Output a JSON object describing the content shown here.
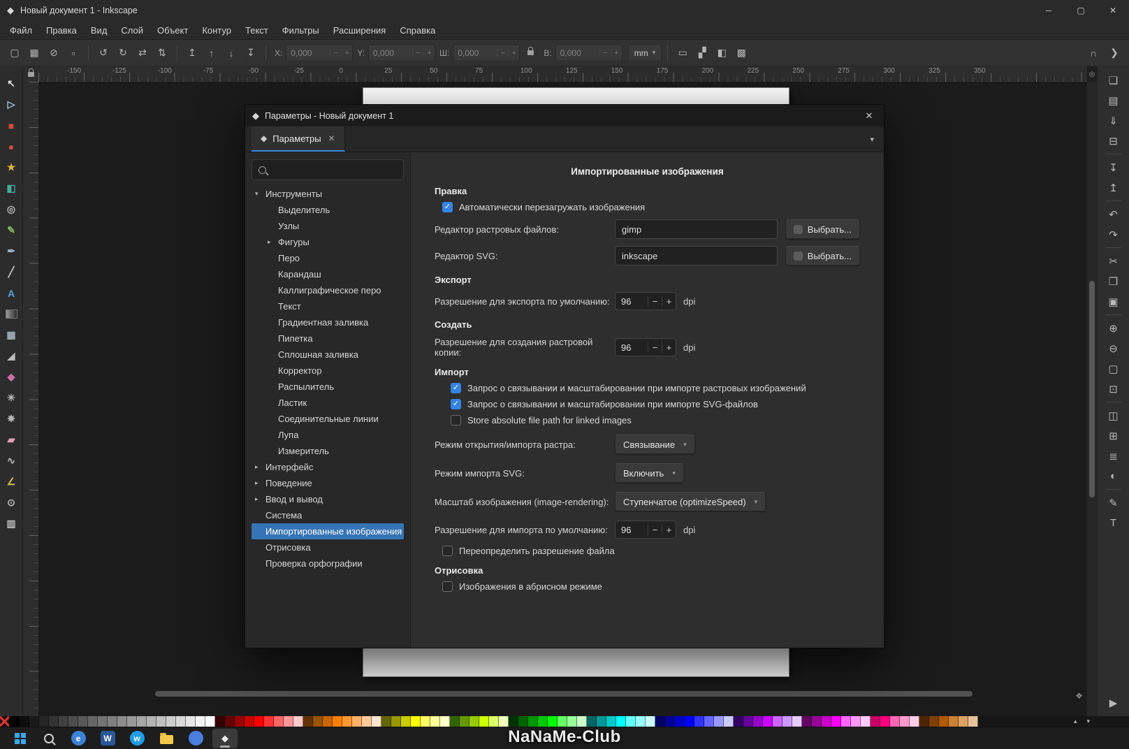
{
  "icons": {
    "app_logo": "◆",
    "minimize": "─",
    "maximize": "▢",
    "close": "✕",
    "chevron_down": "▾",
    "triangle_down": "▾",
    "triangle_right": "▸",
    "check": "✓",
    "minus": "−",
    "plus": "+",
    "palette_up": "▴",
    "palette_down": "▾",
    "snap": "∩",
    "overflow": "❯",
    "corner_circle": "◎",
    "cms": "❖",
    "expander": "▶"
  },
  "window": {
    "title": "Новый документ 1 - Inkscape"
  },
  "menubar": {
    "items": [
      "Файл",
      "Правка",
      "Вид",
      "Слой",
      "Объект",
      "Контур",
      "Текст",
      "Фильтры",
      "Расширения",
      "Справка"
    ]
  },
  "cmdbar": {
    "select_icons": [
      {
        "name": "select-all",
        "glyph": "▢"
      },
      {
        "name": "select-all-layers",
        "glyph": "▦"
      },
      {
        "name": "deselect",
        "glyph": "⊘"
      },
      {
        "name": "rubberband-mode",
        "glyph": "▫"
      }
    ],
    "transform_icons": [
      {
        "name": "rotate-ccw",
        "glyph": "↺"
      },
      {
        "name": "rotate-cw",
        "glyph": "↻"
      },
      {
        "name": "flip-horizontal",
        "glyph": "⇄"
      },
      {
        "name": "flip-vertical",
        "glyph": "⇅"
      }
    ],
    "zorder_icons": [
      {
        "name": "raise-to-top",
        "glyph": "↥"
      },
      {
        "name": "raise",
        "glyph": "↑"
      },
      {
        "name": "lower",
        "glyph": "↓"
      },
      {
        "name": "lower-to-bottom",
        "glyph": "↧"
      }
    ],
    "fields": [
      {
        "label": "X:",
        "value": "0,000"
      },
      {
        "label": "Y:",
        "value": "0,000"
      },
      {
        "label": "Ш:",
        "value": "0,000"
      },
      {
        "label": "В:",
        "value": "0,000"
      }
    ],
    "unit": "mm",
    "affect_icons": [
      {
        "name": "transform-stroke-toggle",
        "glyph": "▭"
      },
      {
        "name": "transform-corners-toggle",
        "glyph": "▞"
      },
      {
        "name": "transform-gradient-toggle",
        "glyph": "◧"
      },
      {
        "name": "transform-pattern-toggle",
        "glyph": "▩"
      }
    ]
  },
  "ruler": {
    "h_labels": [
      "-150",
      "-125",
      "-100",
      "-75",
      "-50",
      "-25",
      "0",
      "25",
      "50",
      "75",
      "100",
      "125",
      "150",
      "175",
      "200",
      "225",
      "250",
      "275",
      "300",
      "325",
      "350"
    ]
  },
  "toolbox": [
    {
      "name": "selector-tool",
      "glyph": "↖",
      "color": "#e0e0e0"
    },
    {
      "name": "node-tool",
      "glyph": "▷",
      "color": "#9fc3e7"
    },
    {
      "name": "rectangle-tool",
      "glyph": "■",
      "color": "#cf4a3f"
    },
    {
      "name": "ellipse-tool",
      "glyph": "●",
      "color": "#d4503c"
    },
    {
      "name": "star-tool",
      "glyph": "★",
      "color": "#ddb63c"
    },
    {
      "name": "box3d-tool",
      "glyph": "◧",
      "color": "#49a89b"
    },
    {
      "name": "spiral-tool",
      "glyph": "◎",
      "color": "#b9b9b9"
    },
    {
      "name": "pencil-tool",
      "glyph": "✎",
      "color": "#86b95c"
    },
    {
      "name": "pen-tool",
      "glyph": "✒",
      "color": "#9fb4c9"
    },
    {
      "name": "calligraphy-tool",
      "glyph": "╱",
      "color": "#c9c9c9"
    },
    {
      "name": "text-tool",
      "glyph": "A",
      "color": "#5e9fdd"
    },
    {
      "name": "gradient-tool",
      "kind": "gradient"
    },
    {
      "name": "mesh-gradient-tool",
      "glyph": "▦",
      "color": "#9fb0bd"
    },
    {
      "name": "dropper-tool",
      "glyph": "◢",
      "color": "#bdbdbd"
    },
    {
      "name": "paint-bucket-tool",
      "glyph": "◆",
      "color": "#cf6fae"
    },
    {
      "name": "tweak-tool",
      "glyph": "✳",
      "color": "#b9b9b9"
    },
    {
      "name": "spray-tool",
      "glyph": "✵",
      "color": "#b9b9b9"
    },
    {
      "name": "eraser-tool",
      "glyph": "▰",
      "color": "#e0a0b8"
    },
    {
      "name": "connector-tool",
      "glyph": "∿",
      "color": "#b9b9b9"
    },
    {
      "name": "measure-tool",
      "glyph": "∠",
      "color": "#d9c44c"
    },
    {
      "name": "zoom-tool",
      "glyph": "⊙",
      "color": "#b9b9b9"
    },
    {
      "name": "pages-tool",
      "glyph": "▥",
      "color": "#b9b9b9"
    }
  ],
  "rpanel": [
    {
      "name": "new-document",
      "glyph": "❏"
    },
    {
      "name": "open-document",
      "glyph": "▤"
    },
    {
      "name": "save-document",
      "glyph": "⇓"
    },
    {
      "name": "print-document",
      "glyph": "⊟"
    },
    "sep",
    {
      "name": "import-image",
      "glyph": "↧"
    },
    {
      "name": "export-image",
      "glyph": "↥"
    },
    "sep",
    {
      "name": "undo",
      "glyph": "↶"
    },
    {
      "name": "redo",
      "glyph": "↷"
    },
    "sep",
    {
      "name": "cut",
      "glyph": "✂"
    },
    {
      "name": "copy",
      "glyph": "❐"
    },
    {
      "name": "paste",
      "glyph": "▣"
    },
    "sep",
    {
      "name": "zoom-in",
      "glyph": "⊕"
    },
    {
      "name": "zoom-out",
      "glyph": "⊖"
    },
    {
      "name": "zoom-page",
      "glyph": "▢"
    },
    {
      "name": "zoom-drawing",
      "glyph": "⊡"
    },
    "sep",
    {
      "name": "duplicate",
      "glyph": "◫"
    },
    {
      "name": "group-objects",
      "glyph": "⊞"
    },
    {
      "name": "layers-dialog",
      "glyph": "≣"
    },
    {
      "name": "fill-stroke-dialog",
      "glyph": "◐"
    },
    "sep",
    {
      "name": "xml-editor",
      "glyph": "✎"
    },
    {
      "name": "text-and-font-dialog",
      "glyph": "T"
    },
    {
      "name": "panel-expander",
      "glyph": "▶",
      "bottom": true
    }
  ],
  "dialog": {
    "title": "Параметры - Новый документ 1",
    "tab": {
      "label": "Параметры"
    },
    "tree": [
      {
        "label": "Инструменты",
        "indent": 0,
        "arrow": "down"
      },
      {
        "label": "Выделитель",
        "indent": 1,
        "arrow": "none"
      },
      {
        "label": "Узлы",
        "indent": 1,
        "arrow": "none"
      },
      {
        "label": "Фигуры",
        "indent": 1,
        "arrow": "right"
      },
      {
        "label": "Перо",
        "indent": 1,
        "arrow": "none"
      },
      {
        "label": "Карандаш",
        "indent": 1,
        "arrow": "none"
      },
      {
        "label": "Каллиграфическое перо",
        "indent": 1,
        "arrow": "none"
      },
      {
        "label": "Текст",
        "indent": 1,
        "arrow": "none"
      },
      {
        "label": "Градиентная заливка",
        "indent": 1,
        "arrow": "none"
      },
      {
        "label": "Пипетка",
        "indent": 1,
        "arrow": "none"
      },
      {
        "label": "Сплошная заливка",
        "indent": 1,
        "arrow": "none"
      },
      {
        "label": "Корректор",
        "indent": 1,
        "arrow": "none"
      },
      {
        "label": "Распылитель",
        "indent": 1,
        "arrow": "none"
      },
      {
        "label": "Ластик",
        "indent": 1,
        "arrow": "none"
      },
      {
        "label": "Соединительные линии",
        "indent": 1,
        "arrow": "none"
      },
      {
        "label": "Лупа",
        "indent": 1,
        "arrow": "none"
      },
      {
        "label": "Измеритель",
        "indent": 1,
        "arrow": "none"
      },
      {
        "label": "Интерфейс",
        "indent": 0,
        "arrow": "right"
      },
      {
        "label": "Поведение",
        "indent": 0,
        "arrow": "right"
      },
      {
        "label": "Ввод и вывод",
        "indent": 0,
        "arrow": "right"
      },
      {
        "label": "Система",
        "indent": 0,
        "arrow": "none"
      },
      {
        "label": "Импортированные изображения",
        "indent": 0,
        "arrow": "none",
        "selected": true
      },
      {
        "label": "Отрисовка",
        "indent": 0,
        "arrow": "none"
      },
      {
        "label": "Проверка орфографии",
        "indent": 0,
        "arrow": "none"
      }
    ],
    "content": {
      "title": "Импортированные изображения",
      "sec_edit": "Правка",
      "chk_autoreload": "Автоматически перезагружать изображения",
      "lbl_bitmap_editor": "Редактор растровых файлов:",
      "val_bitmap_editor": "gimp",
      "btn_choose": "Выбрать...",
      "lbl_svg_editor": "Редактор SVG:",
      "val_svg_editor": "inkscape",
      "sec_export": "Экспорт",
      "lbl_export_dpi": "Разрешение для экспорта по умолчанию:",
      "val_export_dpi": "96",
      "dpi": "dpi",
      "sec_create": "Создать",
      "lbl_create_dpi": "Разрешение для создания растровой копии:",
      "val_create_dpi": "96",
      "sec_import": "Импорт",
      "chk_ask_bitmap": "Запрос о связывании и масштабировании при импорте растровых изображений",
      "chk_ask_svg": "Запрос о связывании и масштабировании при импорте SVG-файлов",
      "chk_store_abs": "Store absolute file path for linked images",
      "lbl_bitmap_import_mode": "Режим открытия/импорта растра:",
      "val_bitmap_import_mode": "Связывание",
      "lbl_svg_import_mode": "Режим импорта SVG:",
      "val_svg_import_mode": "Включить",
      "lbl_image_scale": "Масштаб изображения (image-rendering):",
      "val_image_scale": "Ступенчатое (optimizeSpeed)",
      "lbl_import_dpi": "Разрешение для импорта по умолчанию:",
      "val_import_dpi": "96",
      "chk_override_dpi": "Переопределить разрешение файла",
      "sec_render": "Отрисовка",
      "chk_outline_images": "Изображения в абрисном режиме"
    }
  },
  "palette": {
    "colors": [
      "none",
      "#000000",
      "#0d0d0d",
      "#1a1a1a",
      "#262626",
      "#333333",
      "#404040",
      "#4d4d4d",
      "#595959",
      "#666666",
      "#737373",
      "#808080",
      "#8c8c8c",
      "#999999",
      "#a6a6a6",
      "#b3b3b3",
      "#bfbfbf",
      "#cccccc",
      "#d9d9d9",
      "#e6e6e6",
      "#f2f2f2",
      "#ffffff",
      "#330000",
      "#660000",
      "#990000",
      "#cc0000",
      "#ff0000",
      "#ff3333",
      "#ff6666",
      "#ff9999",
      "#ffcccc",
      "#663300",
      "#995500",
      "#cc6600",
      "#ff8000",
      "#ff9933",
      "#ffb366",
      "#ffcc99",
      "#ffe6cc",
      "#666600",
      "#999900",
      "#cccc00",
      "#ffff00",
      "#ffff66",
      "#ffff99",
      "#ffffcc",
      "#336600",
      "#669900",
      "#99cc00",
      "#ccff00",
      "#ddff66",
      "#eeffbb",
      "#003300",
      "#006600",
      "#009900",
      "#00cc00",
      "#00ff00",
      "#66ff66",
      "#99ff99",
      "#ccffcc",
      "#006666",
      "#009999",
      "#00cccc",
      "#00ffff",
      "#66ffff",
      "#99ffff",
      "#ccffff",
      "#000066",
      "#000099",
      "#0000cc",
      "#0000ff",
      "#3333ff",
      "#6666ff",
      "#9999ff",
      "#ccccff",
      "#330066",
      "#660099",
      "#9900cc",
      "#cc00ff",
      "#cc66ff",
      "#cc99ff",
      "#e6ccff",
      "#660066",
      "#990099",
      "#cc00cc",
      "#ff00ff",
      "#ff66ff",
      "#ff99ff",
      "#ffccff",
      "#cc0066",
      "#ff0080",
      "#ff66b3",
      "#ff99cc",
      "#ffcce6",
      "#4d2600",
      "#804000",
      "#b35900",
      "#cc8033",
      "#d9a366",
      "#e6c299"
    ]
  },
  "taskbar": {
    "watermark": "NaNaMe-Club",
    "apps": [
      {
        "name": "start",
        "kind": "win"
      },
      {
        "name": "search",
        "kind": "search"
      },
      {
        "name": "edge-browser",
        "kind": "circle",
        "color": "#3b82d8",
        "letter": "e"
      },
      {
        "name": "word",
        "kind": "tile",
        "color": "#2b579a",
        "letter": "W"
      },
      {
        "name": "messenger",
        "kind": "circle",
        "color": "#1e9de6",
        "letter": "w"
      },
      {
        "name": "explorer",
        "kind": "folder"
      },
      {
        "name": "browser",
        "kind": "circle",
        "color": "#4a7fe0",
        "letter": ""
      },
      {
        "name": "inkscape",
        "kind": "ink",
        "letter": "◆",
        "active": true
      }
    ]
  }
}
